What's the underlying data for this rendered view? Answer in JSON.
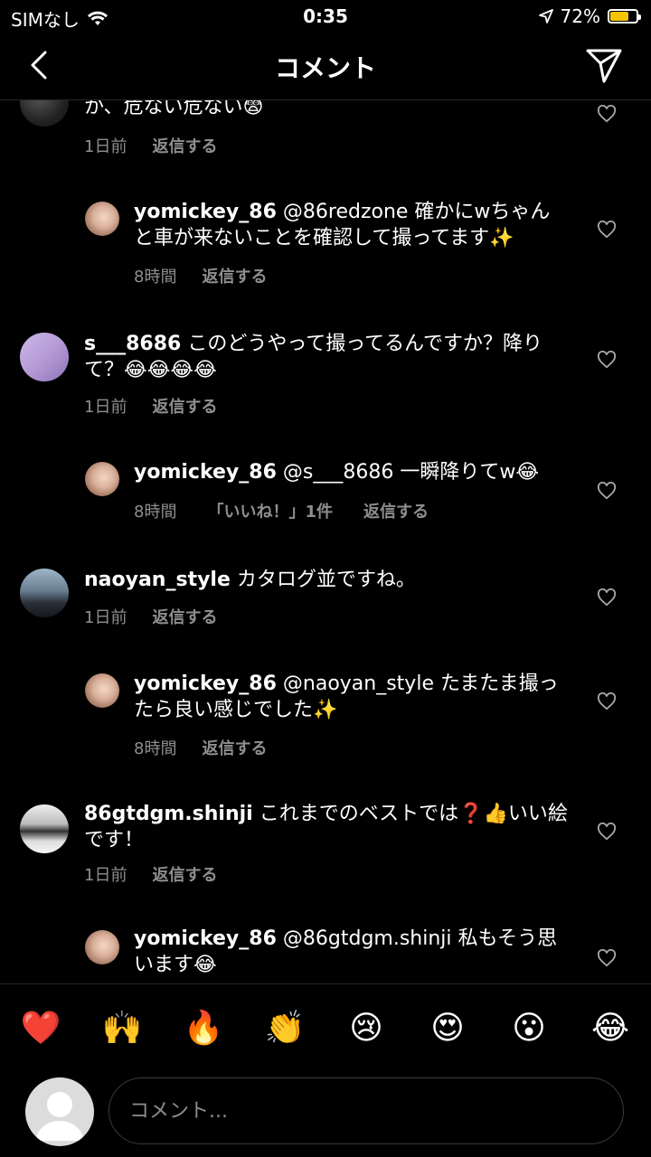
{
  "status": {
    "carrier": "SIMなし",
    "time": "0:35",
    "battery": "72%",
    "battery_level": 0.72
  },
  "nav": {
    "title": "コメント"
  },
  "comments": [
    {
      "text": "か、危ない危ない😨",
      "time": "1日前",
      "reply": "返信する"
    },
    {
      "user": "yomickey_86",
      "text": "@86redzone 確かにwちゃんと車が来ないことを確認して撮ってます✨",
      "time": "8時間",
      "reply": "返信する"
    },
    {
      "user": "s___8686",
      "text": "このどうやって撮ってるんですか？降りて？😂😂😂😂",
      "time": "1日前",
      "reply": "返信する"
    },
    {
      "user": "yomickey_86",
      "text": "@s___8686 一瞬降りてw😂",
      "time": "8時間",
      "likes": "「いいね！」1件",
      "reply": "返信する"
    },
    {
      "user": "naoyan_style",
      "text": "カタログ並ですね。",
      "time": "1日前",
      "reply": "返信する"
    },
    {
      "user": "yomickey_86",
      "text": "@naoyan_style たまたま撮ったら良い感じでした✨",
      "time": "8時間",
      "reply": "返信する"
    },
    {
      "user": "86gtdgm.shinji",
      "text": "これまでのベストでは❓👍いい絵です！",
      "time": "1日前",
      "reply": "返信する"
    },
    {
      "user": "yomickey_86",
      "text": "@86gtdgm.shinji 私もそう思います😂"
    }
  ],
  "emoji_bar": [
    "❤️",
    "🙌",
    "🔥",
    "👏",
    "😢",
    "😍",
    "😮",
    "😂"
  ],
  "input": {
    "placeholder": "コメント..."
  }
}
